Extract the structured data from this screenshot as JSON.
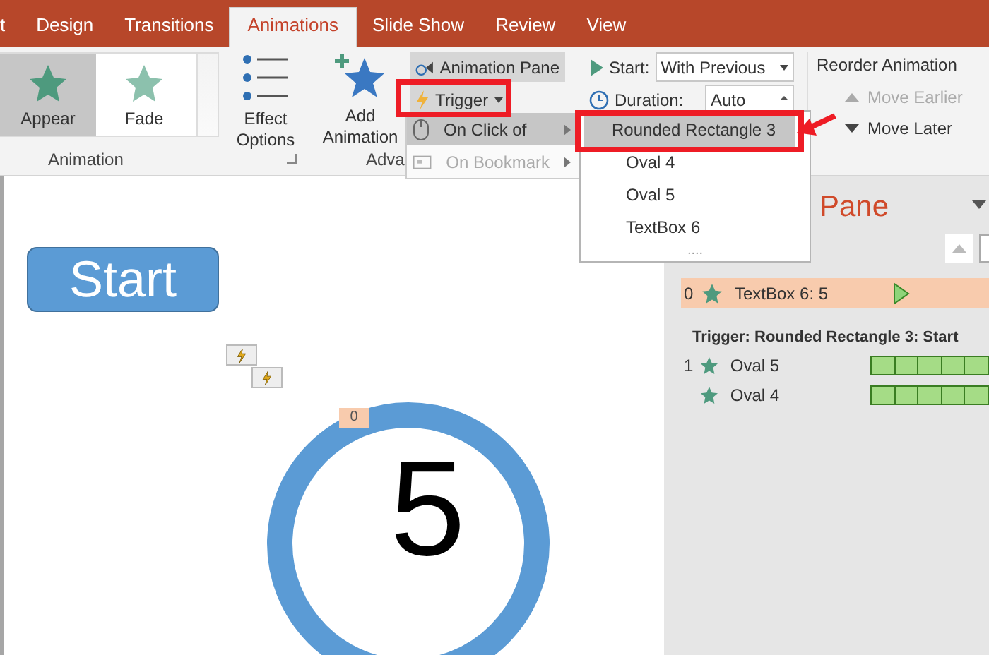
{
  "tabs": [
    {
      "label": "t",
      "selected": false
    },
    {
      "label": "Design",
      "selected": false
    },
    {
      "label": "Transitions",
      "selected": false
    },
    {
      "label": "Animations",
      "selected": true
    },
    {
      "label": "Slide Show",
      "selected": false
    },
    {
      "label": "Review",
      "selected": false
    },
    {
      "label": "View",
      "selected": false
    }
  ],
  "ribbon": {
    "gallery": [
      {
        "label": "Appear",
        "selected": true
      },
      {
        "label": "Fade",
        "selected": false
      }
    ],
    "effect_options": "Effect Options",
    "add_animation": "Add Animation",
    "animation_pane": "Animation Pane",
    "trigger": "Trigger",
    "start_label": "Start:",
    "start_value": "With Previous",
    "duration_label": "Duration:",
    "duration_value": "Auto",
    "reorder_title": "Reorder Animation",
    "reorder": [
      {
        "label": "Move Earlier",
        "disabled": true
      },
      {
        "label": "Move Later",
        "disabled": false
      }
    ],
    "groups": [
      "Animation",
      "Adva"
    ]
  },
  "trigger_menu": [
    {
      "label": "On Click of",
      "selected": true,
      "disabled": false
    },
    {
      "label": "On Bookmark",
      "selected": false,
      "disabled": true
    }
  ],
  "submenu": {
    "items": [
      {
        "label": "Rounded Rectangle 3",
        "selected": true
      },
      {
        "label": "Oval 4",
        "selected": false
      },
      {
        "label": "Oval 5",
        "selected": false
      },
      {
        "label": "TextBox 6",
        "selected": false
      }
    ],
    "more": "...."
  },
  "slide": {
    "start_shape": "Start",
    "counter": "5",
    "badge": "0"
  },
  "pane": {
    "title": "Pane",
    "rows": [
      {
        "number": "0",
        "label": "TextBox 6: 5",
        "selected": true
      }
    ],
    "trigger_heading": "Trigger: Rounded Rectangle 3: Start",
    "trigger_items": [
      {
        "number": "1",
        "label": "Oval 5"
      },
      {
        "label": "Oval 4"
      }
    ]
  }
}
